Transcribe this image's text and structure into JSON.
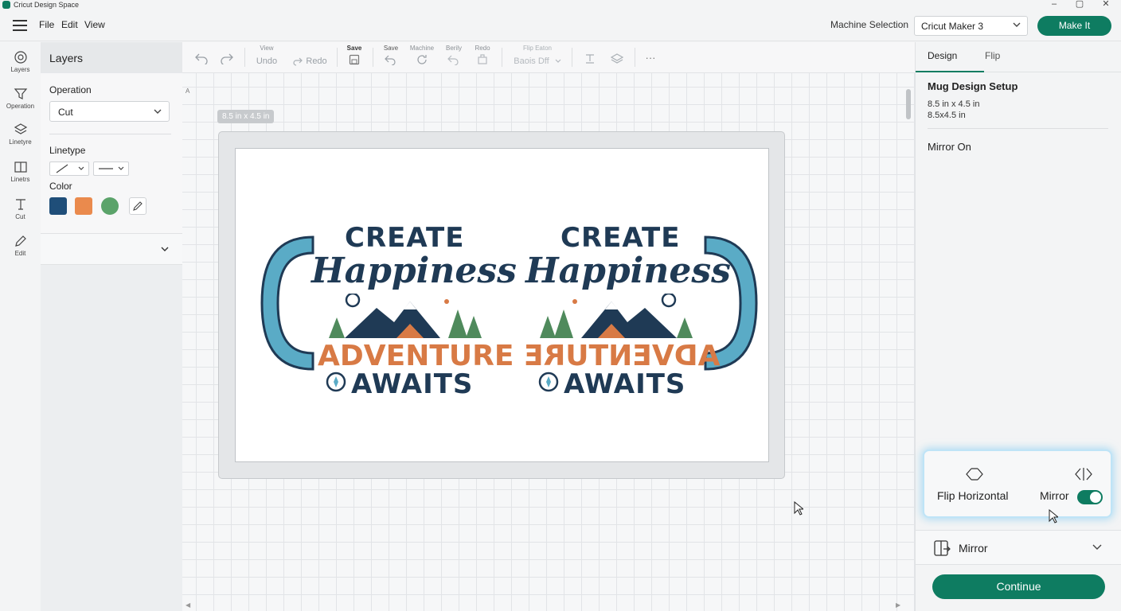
{
  "app": {
    "title": "Cricut Design Space",
    "window_controls": [
      "–",
      "▢",
      "✕"
    ]
  },
  "menu": {
    "items": [
      "File",
      "Edit",
      "View"
    ]
  },
  "machine": {
    "label": "Machine Selection",
    "selected": "Cricut Maker 3",
    "make_it": "Make It"
  },
  "rail": {
    "items": [
      "Layers",
      "Operation",
      "Linetyre",
      "Linetrs",
      "Cut",
      "Edit"
    ]
  },
  "layers": {
    "title": "Layers",
    "operation_label": "Operation",
    "operation_value": "Cut",
    "linetype_label": "Linetype",
    "color_label": "Color",
    "swatches": [
      "#1f4e79",
      "#ea8a4d",
      "#5ba36a"
    ]
  },
  "toolbar": {
    "view_caption": "View",
    "undo_label": "Undo",
    "redo_label": "Redo",
    "save_caption": "Save",
    "save2_caption": "Save",
    "machine_caption": "Machine",
    "berily_caption": "Berily",
    "redo_caption": "Redo",
    "flip_caption": "Flip Eaton",
    "flip_value": "Baois Dff",
    "more": "···"
  },
  "canvas": {
    "ruler_mark": "A",
    "dimension_badge": "8.5 in x 4.5 in",
    "design": {
      "line1": "CREATE",
      "line2": "Happiness",
      "line3": "ADVENTURE",
      "line4": "AWAITS"
    }
  },
  "right_panel": {
    "tabs": [
      "Design",
      "Flip"
    ],
    "setup_title": "Mug Design Setup",
    "setup_line1": "8.5 in x 4.5 in",
    "setup_line2": "8.5x4.5 in",
    "mirror_status": "Mirror On",
    "flip_horizontal_label": "Flip Horizontal",
    "mirror_label": "Mirror",
    "mirror_enabled": true,
    "mirror_row_label": "Mirror",
    "continue_label": "Continue"
  },
  "colors": {
    "accent": "#0e7c61",
    "navy": "#1f3a55",
    "orange": "#d87a45",
    "teal": "#5aabc6",
    "green": "#4f8a5c"
  }
}
